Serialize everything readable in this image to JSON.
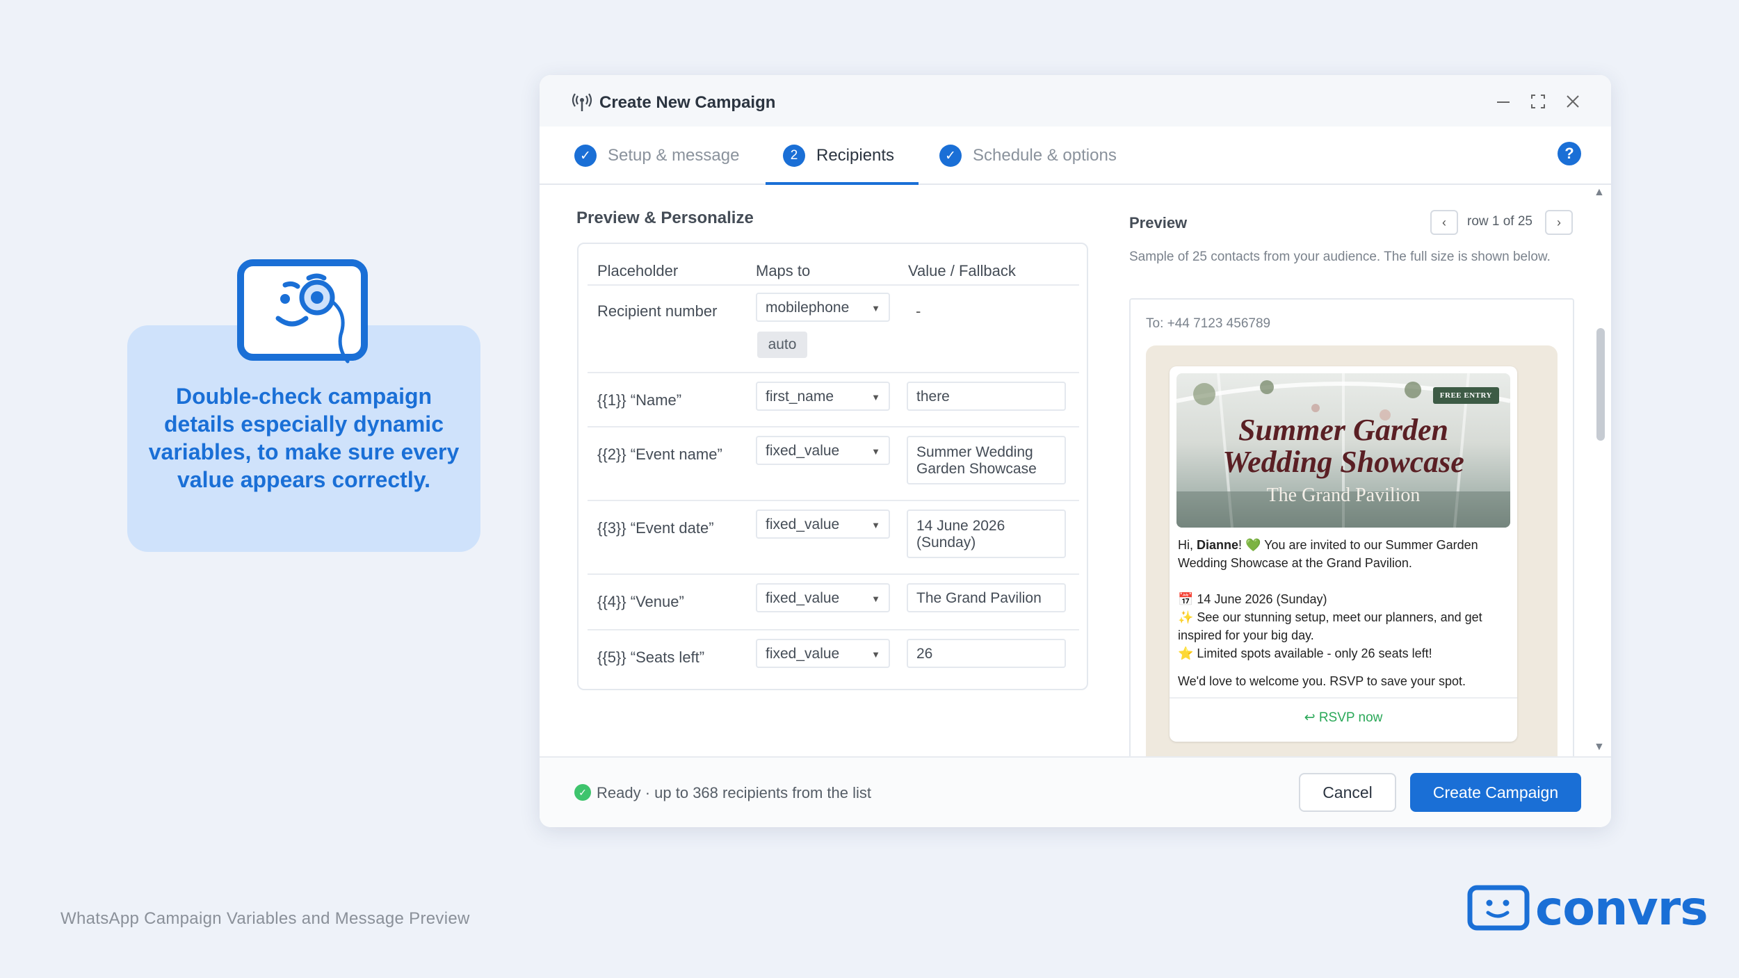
{
  "callout": {
    "text": "Double-check campaign details especially dynamic variables, to make sure every value appears correctly.",
    "icon": "mascot-monocle-icon"
  },
  "footer": {
    "caption": "WhatsApp Campaign Variables and Message Preview"
  },
  "brand": {
    "name": "convrs",
    "color": "#1a6fd6"
  },
  "modal": {
    "title": "Create New Campaign",
    "steps": [
      {
        "label": "Setup & message",
        "state": "done"
      },
      {
        "label": "Recipients",
        "number": "2",
        "state": "active"
      },
      {
        "label": "Schedule & options",
        "state": "done"
      }
    ],
    "help_label": "?",
    "section_title": "Preview & Personalize",
    "table": {
      "headers": [
        "Placeholder",
        "Maps to",
        "Value / Fallback"
      ],
      "rows": [
        {
          "placeholder": "Recipient number",
          "maps_to": "mobilephone",
          "chip": "auto",
          "value": "-"
        },
        {
          "placeholder": "{{1}} “Name”",
          "maps_to": "first_name",
          "value": "there"
        },
        {
          "placeholder": "{{2}} “Event name”",
          "maps_to": "fixed_value",
          "value": "Summer Wedding Garden Showcase"
        },
        {
          "placeholder": "{{3}} “Event date”",
          "maps_to": "fixed_value",
          "value": "14 June 2026 (Sunday)"
        },
        {
          "placeholder": "{{4}} “Venue”",
          "maps_to": "fixed_value",
          "value": "The Grand Pavilion"
        },
        {
          "placeholder": "{{5}} “Seats left”",
          "maps_to": "fixed_value",
          "value": "26"
        }
      ]
    },
    "preview": {
      "title": "Preview",
      "pager": "row 1 of 25",
      "description": "Sample of 25 contacts from your audience. The full size is shown below.",
      "to": "To: +44 7123 456789",
      "image": {
        "badge": "FREE ENTRY",
        "title_line1": "Summer Garden",
        "title_line2": "Wedding Showcase",
        "subtitle": "The Grand Pavilion"
      },
      "message": {
        "greeting_prefix": "Hi, ",
        "name": "Dianne",
        "greeting_suffix": "! 💚 You are invited to our Summer Garden Wedding Showcase at the Grand Pavilion.",
        "date_line": "📅 14 June 2026 (Sunday)",
        "setup_line": "✨ See our stunning setup, meet our planners, and get inspired for your big day.",
        "spots_line": "⭐ Limited spots available - only 26 seats left!",
        "closing": "We'd love to welcome you. RSVP to save your spot."
      },
      "button": "RSVP now"
    },
    "footer": {
      "status": "Ready · up to 368 recipients from the list",
      "cancel": "Cancel",
      "create": "Create Campaign"
    }
  }
}
